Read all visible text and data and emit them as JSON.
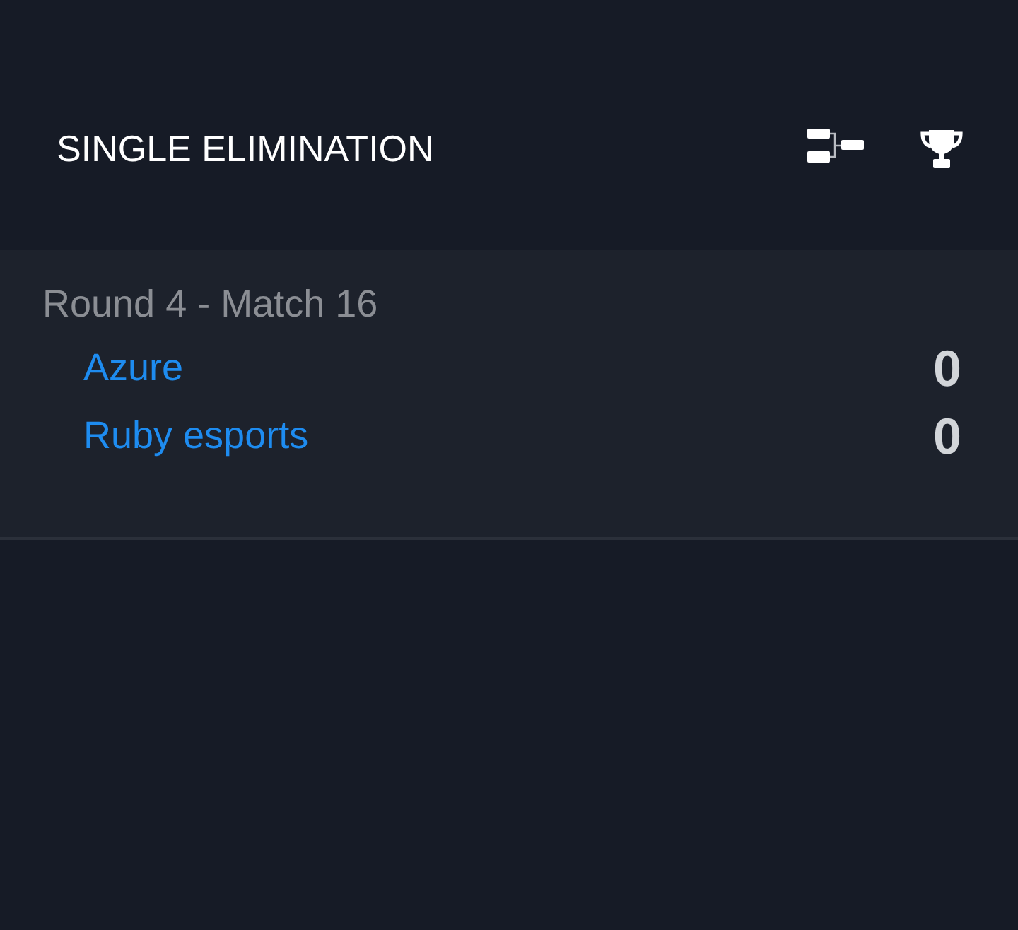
{
  "header": {
    "title": "SINGLE ELIMINATION"
  },
  "match": {
    "label": "Round 4 - Match 16",
    "teams": [
      {
        "name": "Azure",
        "score": "0"
      },
      {
        "name": "Ruby esports",
        "score": "0"
      }
    ]
  }
}
